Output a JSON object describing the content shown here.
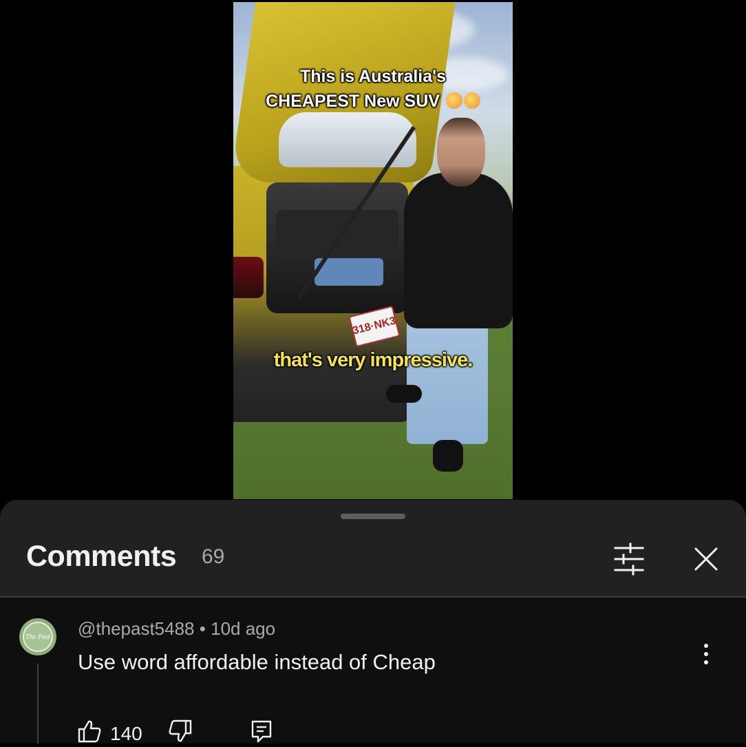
{
  "video": {
    "caption_top_line1": "This is Australia's",
    "caption_top_line2": "CHEAPEST New SUV",
    "caption_bottom": "that's very impressive.",
    "plate_text": "318·NK3"
  },
  "comments_panel": {
    "title": "Comments",
    "count": "69",
    "icons": {
      "filter": "filter-sliders-icon",
      "close": "close-icon"
    }
  },
  "comment": {
    "author": "@thepast5488",
    "separator": "•",
    "time": "10d ago",
    "text": "Use word affordable instead of Cheap",
    "likes": "140",
    "avatar_text": "The Past"
  },
  "colors": {
    "panel_bg": "#212121",
    "comment_bg": "#0f0f0f",
    "muted_text": "#aaaaaa",
    "caption_yellow": "#f3e34f"
  }
}
